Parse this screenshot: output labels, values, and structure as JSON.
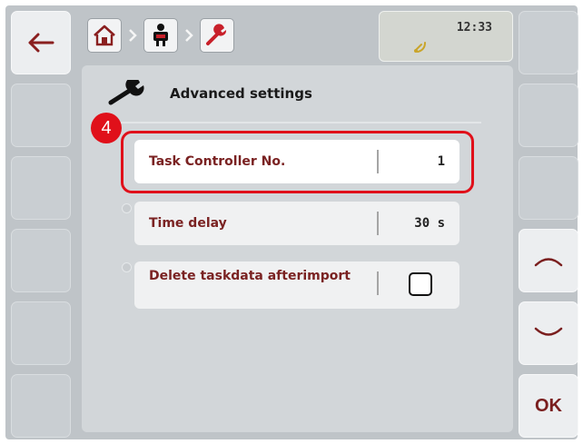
{
  "colors": {
    "accent": "#7a2222",
    "highlight": "#e0101a",
    "panel": "#d2d6d9"
  },
  "header": {
    "back_icon": "arrow-left-icon",
    "breadcrumb": [
      "home-icon",
      "terminal-operator-icon",
      "wrench-icon"
    ],
    "status": {
      "time": "12:33",
      "icon": "satellite-signal-icon"
    }
  },
  "page": {
    "title": "Advanced settings",
    "title_icon": "wrench-icon"
  },
  "rows": [
    {
      "label": "Task Controller No.",
      "value": "1",
      "selected": true
    },
    {
      "label": "Time delay",
      "value": "30 s",
      "selected": false
    },
    {
      "label_lines": [
        "Delete taskdata after",
        "import"
      ],
      "checked": false
    }
  ],
  "annotation": {
    "marker": "4"
  },
  "right_panel": {
    "up_icon": "chevron-up-icon",
    "down_icon": "chevron-down-icon",
    "ok_label": "OK"
  }
}
